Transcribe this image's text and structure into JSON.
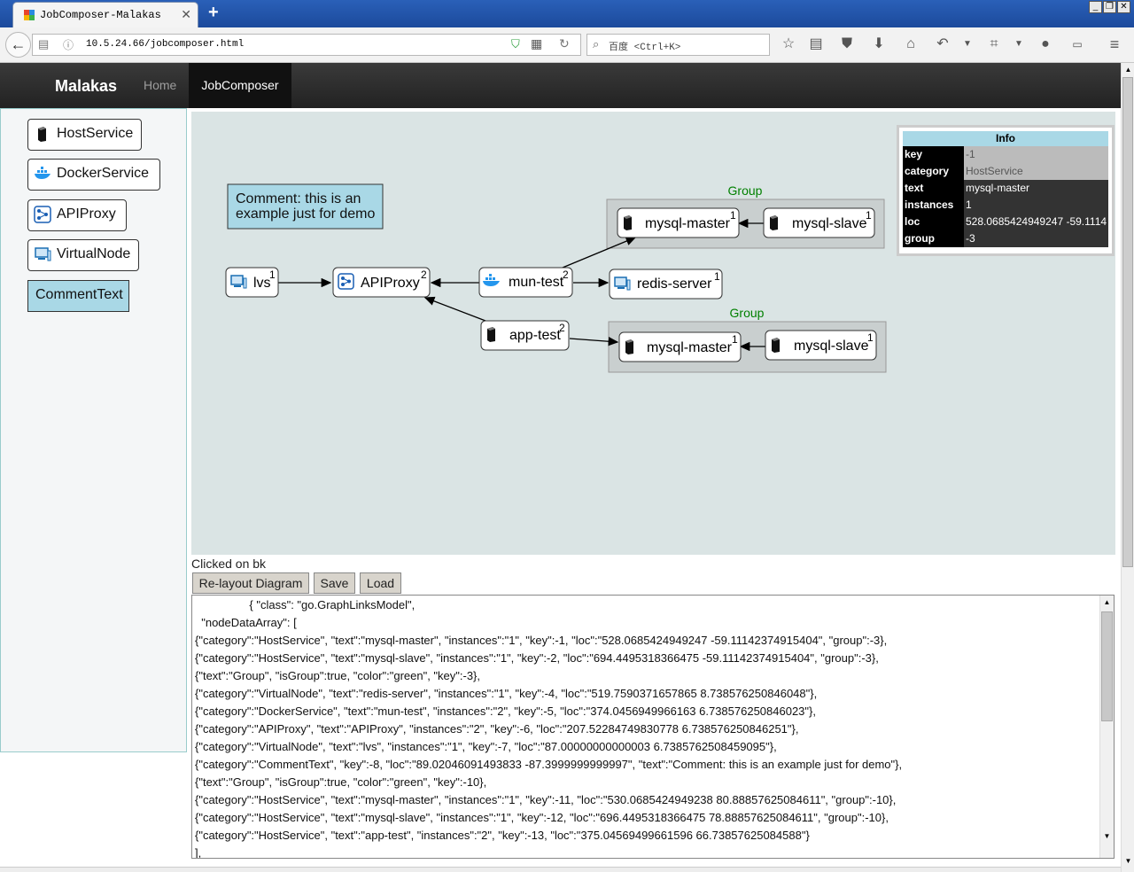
{
  "browser": {
    "tab_title": "JobComposer-Malakas",
    "url": "10.5.24.66/jobcomposer.html",
    "search_placeholder": "百度 <Ctrl+K>"
  },
  "navbar": {
    "brand": "Malakas",
    "links": [
      "Home",
      "JobComposer"
    ],
    "active": "JobComposer"
  },
  "palette": {
    "items": [
      {
        "label": "HostService",
        "icon": "server-icon"
      },
      {
        "label": "DockerService",
        "icon": "docker-whale-icon"
      },
      {
        "label": "APIProxy",
        "icon": "network-hub-icon"
      },
      {
        "label": "VirtualNode",
        "icon": "monitor-icon"
      },
      {
        "label": "CommentText",
        "icon": ""
      }
    ]
  },
  "diagram": {
    "comment": "Comment: this is an example just for demo",
    "comment_line1": "Comment: this is an",
    "comment_line2": "example just for demo",
    "groups": [
      {
        "label": "Group",
        "color": "green"
      },
      {
        "label": "Group",
        "color": "green"
      }
    ],
    "nodes": [
      {
        "id": "lvs",
        "text": "lvs",
        "instances": "1",
        "icon": "monitor-icon"
      },
      {
        "id": "apiproxy",
        "text": "APIProxy",
        "instances": "2",
        "icon": "network-hub-icon"
      },
      {
        "id": "mun-test",
        "text": "mun-test",
        "instances": "2",
        "icon": "docker-whale-icon"
      },
      {
        "id": "redis-server",
        "text": "redis-server",
        "instances": "1",
        "icon": "monitor-icon"
      },
      {
        "id": "app-test",
        "text": "app-test",
        "instances": "2",
        "icon": "server-icon"
      },
      {
        "id": "mysql-master-1",
        "text": "mysql-master",
        "instances": "1",
        "icon": "server-icon"
      },
      {
        "id": "mysql-slave-1",
        "text": "mysql-slave",
        "instances": "1",
        "icon": "server-icon"
      },
      {
        "id": "mysql-master-2",
        "text": "mysql-master",
        "instances": "1",
        "icon": "server-icon"
      },
      {
        "id": "mysql-slave-2",
        "text": "mysql-slave",
        "instances": "1",
        "icon": "server-icon"
      }
    ]
  },
  "info": {
    "title": "Info",
    "rows": [
      {
        "key": "key",
        "value": "-1"
      },
      {
        "key": "category",
        "value": "HostService"
      },
      {
        "key": "text",
        "value": "mysql-master"
      },
      {
        "key": "instances",
        "value": "1"
      },
      {
        "key": "loc",
        "value": "528.0685424949247 -59.1114"
      },
      {
        "key": "group",
        "value": "-3"
      }
    ]
  },
  "status": "Clicked on bk",
  "actions": [
    "Re-layout Diagram",
    "Save",
    "Load"
  ],
  "model_json_lines": [
    "                 { \"class\": \"go.GraphLinksModel\",",
    "  \"nodeDataArray\": [",
    "{\"category\":\"HostService\", \"text\":\"mysql-master\", \"instances\":\"1\", \"key\":-1, \"loc\":\"528.0685424949247 -59.11142374915404\", \"group\":-3},",
    "{\"category\":\"HostService\", \"text\":\"mysql-slave\", \"instances\":\"1\", \"key\":-2, \"loc\":\"694.4495318366475 -59.11142374915404\", \"group\":-3},",
    "{\"text\":\"Group\", \"isGroup\":true, \"color\":\"green\", \"key\":-3},",
    "{\"category\":\"VirtualNode\", \"text\":\"redis-server\", \"instances\":\"1\", \"key\":-4, \"loc\":\"519.7590371657865 8.738576250846048\"},",
    "{\"category\":\"DockerService\", \"text\":\"mun-test\", \"instances\":\"2\", \"key\":-5, \"loc\":\"374.0456949966163 6.738576250846023\"},",
    "{\"category\":\"APIProxy\", \"text\":\"APIProxy\", \"instances\":\"2\", \"key\":-6, \"loc\":\"207.52284749830778 6.738576250846251\"},",
    "{\"category\":\"VirtualNode\", \"text\":\"lvs\", \"instances\":\"1\", \"key\":-7, \"loc\":\"87.00000000000003 6.7385762508459095\"},",
    "{\"category\":\"CommentText\", \"key\":-8, \"loc\":\"89.02046091493833 -87.3999999999997\", \"text\":\"Comment: this is an example just for demo\"},",
    "{\"text\":\"Group\", \"isGroup\":true, \"color\":\"green\", \"key\":-10},",
    "{\"category\":\"HostService\", \"text\":\"mysql-master\", \"instances\":\"1\", \"key\":-11, \"loc\":\"530.0685424949238 80.88857625084611\", \"group\":-10},",
    "{\"category\":\"HostService\", \"text\":\"mysql-slave\", \"instances\":\"1\", \"key\":-12, \"loc\":\"696.4495318366475 78.88857625084611\", \"group\":-10},",
    "{\"category\":\"HostService\", \"text\":\"app-test\", \"instances\":\"2\", \"key\":-13, \"loc\":\"375.04569499661596 66.73857625084588\"}",
    "],"
  ],
  "colors": {
    "navbar_bg": "#222222",
    "diagram_bg": "#dae4e4",
    "comment_bg": "#a9d8e6",
    "group_label": "#008000"
  }
}
